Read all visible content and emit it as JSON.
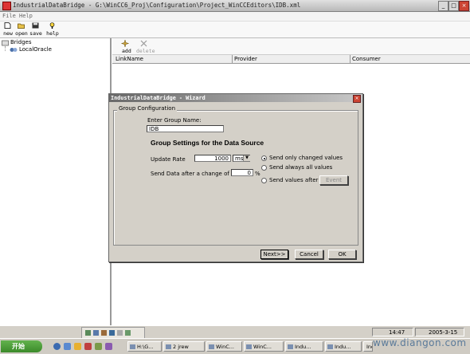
{
  "window": {
    "title": "IndustrialDataBridge - G:\\WinCC6_Proj\\Configuration\\Project_WinCCEditors\\IDB.xml"
  },
  "menu": [
    "File",
    "Help"
  ],
  "toolbar": [
    {
      "label": "new",
      "icon": "new-file-icon"
    },
    {
      "label": "open",
      "icon": "open-folder-icon"
    },
    {
      "label": "save",
      "icon": "floppy-disk-icon"
    },
    {
      "label": "help",
      "icon": "help-icon"
    }
  ],
  "tree": {
    "root": "Bridges",
    "child": "LocalOracle"
  },
  "right_toolbar": {
    "add": "add",
    "delete": "delete"
  },
  "columns": [
    "LinkName",
    "Provider",
    "Consumer"
  ],
  "dialog": {
    "title": "IndustrialDataBridge - Wizard",
    "group_label": "Group Configuration",
    "name_label": "Enter Group Name:",
    "name_value": "IDB",
    "settings_heading": "Group Settings for the Data Source",
    "update_rate_label": "Update Rate",
    "update_rate_value": "1000",
    "update_rate_unit": "ms",
    "send_change_label": "Send Data after a change of",
    "send_change_value": "0",
    "send_change_unit": "%",
    "radio_options": [
      {
        "label": "Send only changed values",
        "selected": true
      },
      {
        "label": "Send always all values",
        "selected": false
      },
      {
        "label": "Send values after",
        "selected": false
      }
    ],
    "event_button": "Event",
    "buttons": {
      "next": "Next>>",
      "cancel": "Cancel",
      "ok": "OK"
    }
  },
  "statusbar": {
    "time": "14:47",
    "date": "2005-3-15"
  },
  "taskbar": {
    "start": "开始",
    "tasks": [
      "H:\\G...",
      "2 jrew",
      "WinC...",
      "WinC...",
      "Indu...",
      "Indu...",
      "Indu..."
    ]
  },
  "watermark": "www.diangon.com"
}
